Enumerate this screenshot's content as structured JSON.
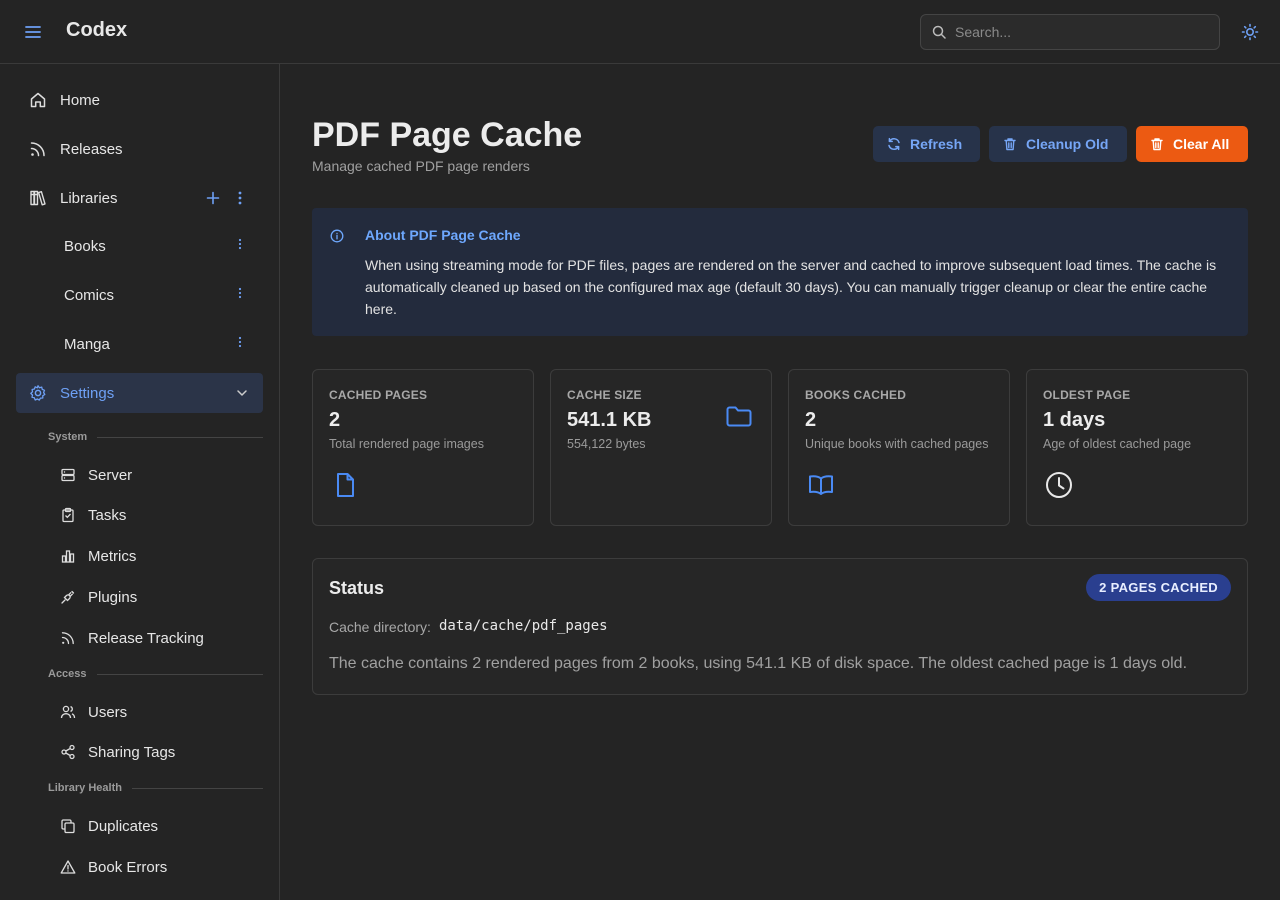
{
  "header": {
    "app_title": "Codex",
    "search_placeholder": "Search...",
    "menu_icon": "hamburger-icon",
    "theme_icon": "sun-icon"
  },
  "sidebar": {
    "items": [
      {
        "label": "Home",
        "icon": "home-icon"
      },
      {
        "label": "Releases",
        "icon": "rss-icon"
      },
      {
        "label": "Libraries",
        "icon": "library-icon"
      }
    ],
    "libraries": [
      {
        "label": "Books"
      },
      {
        "label": "Comics"
      },
      {
        "label": "Manga"
      }
    ],
    "settings": {
      "label": "Settings",
      "icon": "gear-icon"
    },
    "sections": {
      "system": "System",
      "access": "Access",
      "library_health": "Library Health"
    },
    "system_items": [
      {
        "label": "Server",
        "icon": "server-icon"
      },
      {
        "label": "Tasks",
        "icon": "clipboard-icon"
      },
      {
        "label": "Metrics",
        "icon": "bar-chart-icon"
      },
      {
        "label": "Plugins",
        "icon": "plug-icon"
      },
      {
        "label": "Release Tracking",
        "icon": "rss-icon"
      }
    ],
    "access_items": [
      {
        "label": "Users",
        "icon": "users-icon"
      },
      {
        "label": "Sharing Tags",
        "icon": "share-icon"
      }
    ],
    "health_items": [
      {
        "label": "Duplicates",
        "icon": "copy-icon"
      },
      {
        "label": "Book Errors",
        "icon": "warning-icon"
      }
    ]
  },
  "main": {
    "title": "PDF Page Cache",
    "subtitle": "Manage cached PDF page renders",
    "buttons": {
      "refresh": "Refresh",
      "cleanup": "Cleanup Old",
      "clear": "Clear All"
    },
    "info": {
      "title": "About PDF Page Cache",
      "body": "When using streaming mode for PDF files, pages are rendered on the server and cached to improve subsequent load times. The cache is automatically cleaned up based on the configured max age (default 30 days). You can manually trigger cleanup or clear the entire cache here."
    },
    "stats": [
      {
        "label": "CACHED PAGES",
        "value": "2",
        "sub": "Total rendered page images",
        "icon": "file-icon"
      },
      {
        "label": "CACHE SIZE",
        "value": "541.1 KB",
        "sub": "554,122 bytes",
        "icon": "folder-icon"
      },
      {
        "label": "BOOKS CACHED",
        "value": "2",
        "sub": "Unique books with cached pages",
        "icon": "book-open-icon"
      },
      {
        "label": "OLDEST PAGE",
        "value": "1 days",
        "sub": "Age of oldest cached page",
        "icon": "clock-icon"
      }
    ],
    "status": {
      "title": "Status",
      "badge": "2 PAGES CACHED",
      "dir_label": "Cache directory:",
      "dir_value": "data/cache/pdf_pages",
      "description": "The cache contains 2 rendered pages from 2 books, using 541.1 KB of disk space. The oldest cached page is 1 days old."
    }
  },
  "colors": {
    "background": "#242424",
    "accent": "#6ea0f5",
    "danger": "#ec5a12",
    "info_bg": "#232b3d",
    "badge_bg": "#2a3f8f"
  }
}
